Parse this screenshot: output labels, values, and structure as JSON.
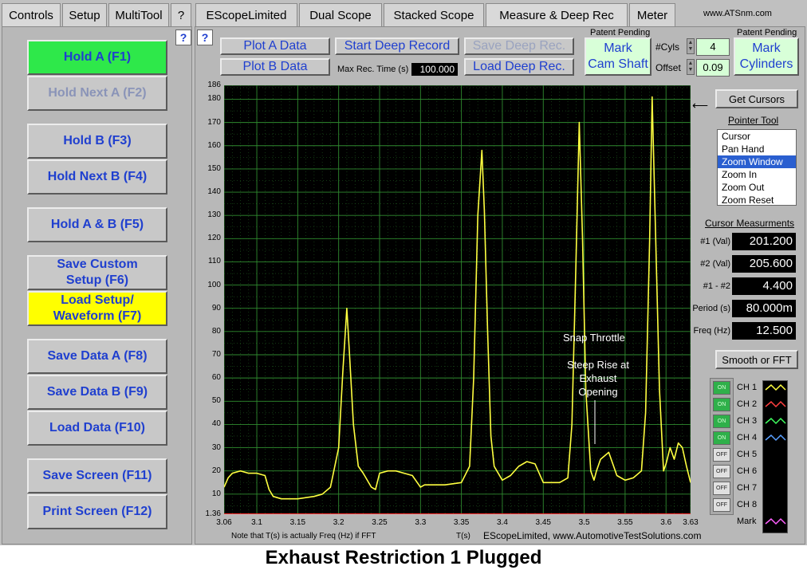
{
  "left_tabs": [
    "Controls",
    "Setup",
    "MultiTool",
    "?"
  ],
  "main_tabs": [
    "EScopeLimited",
    "Dual Scope",
    "Stacked Scope",
    "Measure & Deep Rec",
    "Meter"
  ],
  "brand_url": "www.ATSnm.com",
  "help_label": "?",
  "function_buttons": [
    {
      "label": "Hold A (F1)",
      "state": "green"
    },
    {
      "label": "Hold Next A (F2)",
      "state": "dim"
    },
    {
      "label": "Hold B (F3)",
      "state": "normal"
    },
    {
      "label": "Hold Next B (F4)",
      "state": "normal"
    },
    {
      "label": "Hold A & B (F5)",
      "state": "normal"
    },
    {
      "label": "Save Custom\nSetup (F6)",
      "state": "normal"
    },
    {
      "label": "Load Setup/\nWaveform (F7)",
      "state": "yellow"
    },
    {
      "label": "Save Data A (F8)",
      "state": "normal"
    },
    {
      "label": "Save Data B (F9)",
      "state": "normal"
    },
    {
      "label": "Load Data (F10)",
      "state": "normal"
    },
    {
      "label": "Save Screen (F11)",
      "state": "normal"
    },
    {
      "label": "Print Screen (F12)",
      "state": "normal"
    }
  ],
  "toolbar": {
    "plot_a": "Plot A Data",
    "plot_b": "Plot B Data",
    "start_deep": "Start Deep Record",
    "save_deep": "Save Deep Rec.",
    "load_deep": "Load Deep Rec.",
    "max_rec_label": "Max Rec. Time (s)",
    "max_rec_value": "100.000",
    "patent_pending": "Patent Pending",
    "mark_cam": "Mark\nCam Shaft",
    "cyls_label": "#Cyls",
    "cyls_value": "4",
    "offset_label": "Offset",
    "offset_value": "0.09",
    "mark_cyl": "Mark\nCylinders"
  },
  "right_panel": {
    "get_cursors": "Get Cursors",
    "pointer_tool_title": "Pointer Tool",
    "pointer_tools": [
      "Cursor",
      "Pan Hand",
      "Zoom Window",
      "Zoom In",
      "Zoom Out",
      "Zoom Reset"
    ],
    "pointer_selected_index": 2,
    "cursor_meas_title": "Cursor Measurments",
    "measurements": [
      {
        "label": "#1 (Val)",
        "value": "201.200"
      },
      {
        "label": "#2 (Val)",
        "value": "205.600"
      },
      {
        "label": "#1 - #2",
        "value": "4.400"
      },
      {
        "label": "Period (s)",
        "value": "80.000m"
      },
      {
        "label": "Freq (Hz)",
        "value": "12.500"
      }
    ],
    "smooth_fft": "Smooth or FFT",
    "channels": [
      {
        "name": "CH 1",
        "state": "ON",
        "color": "#ffff40"
      },
      {
        "name": "CH 2",
        "state": "ON",
        "color": "#ff4040"
      },
      {
        "name": "CH 3",
        "state": "ON",
        "color": "#40ff60"
      },
      {
        "name": "CH 4",
        "state": "ON",
        "color": "#5aa0ff"
      },
      {
        "name": "CH 5",
        "state": "OFF",
        "color": ""
      },
      {
        "name": "CH 6",
        "state": "OFF",
        "color": ""
      },
      {
        "name": "CH 7",
        "state": "OFF",
        "color": ""
      },
      {
        "name": "CH 8",
        "state": "OFF",
        "color": ""
      },
      {
        "name": "Mark",
        "state": "",
        "color": "#ff60ff"
      }
    ]
  },
  "chart_footer": {
    "fft_note": "Note that T(s) is actually Freq (Hz) if FFT",
    "t_label": "T(s)",
    "watermark": "EScopeLimited, www.AutomotiveTestSolutions.com"
  },
  "annotations": {
    "snap": "Snap Throttle",
    "steep": "Steep Rise at\nExhaust\nOpening"
  },
  "caption": "Exhaust Restriction 1 Plugged",
  "chart_data": {
    "type": "line",
    "xlim": [
      3.06,
      3.63
    ],
    "ylim": [
      1.36,
      186
    ],
    "x_ticks": [
      "3.06",
      "3.1",
      "3.15",
      "3.2",
      "3.25",
      "3.3",
      "3.35",
      "3.4",
      "3.45",
      "3.5",
      "3.55",
      "3.6",
      "3.63"
    ],
    "x_tick_values": [
      3.06,
      3.1,
      3.15,
      3.2,
      3.25,
      3.3,
      3.35,
      3.4,
      3.45,
      3.5,
      3.55,
      3.6,
      3.63
    ],
    "y_ticks": [
      "186",
      "180",
      "170",
      "160",
      "150",
      "140",
      "130",
      "120",
      "110",
      "100",
      "90",
      "80",
      "70",
      "60",
      "50",
      "40",
      "30",
      "20",
      "10",
      "1.36"
    ],
    "y_tick_values": [
      186,
      180,
      170,
      160,
      150,
      140,
      130,
      120,
      110,
      100,
      90,
      80,
      70,
      60,
      50,
      40,
      30,
      20,
      10,
      1.36
    ],
    "grid": true,
    "series": [
      {
        "color": "#ffff40",
        "x": [
          3.06,
          3.065,
          3.07,
          3.08,
          3.09,
          3.1,
          3.11,
          3.115,
          3.12,
          3.13,
          3.15,
          3.17,
          3.18,
          3.19,
          3.2,
          3.205,
          3.21,
          3.213,
          3.218,
          3.224,
          3.23,
          3.24,
          3.245,
          3.25,
          3.26,
          3.27,
          3.28,
          3.29,
          3.3,
          3.305,
          3.31,
          3.33,
          3.35,
          3.36,
          3.365,
          3.37,
          3.375,
          3.378,
          3.382,
          3.386,
          3.39,
          3.4,
          3.41,
          3.42,
          3.43,
          3.44,
          3.45,
          3.46,
          3.47,
          3.48,
          3.485,
          3.49,
          3.494,
          3.498,
          3.502,
          3.508,
          3.512,
          3.515,
          3.52,
          3.53,
          3.54,
          3.55,
          3.56,
          3.57,
          3.575,
          3.58,
          3.583,
          3.587,
          3.592,
          3.597,
          3.6,
          3.605,
          3.61,
          3.615,
          3.62,
          3.625,
          3.63
        ],
        "y": [
          13,
          17,
          19,
          20,
          19,
          19,
          18,
          12,
          9,
          8,
          8,
          9,
          10,
          13,
          30,
          62,
          90,
          72,
          40,
          22,
          19,
          13,
          12,
          19,
          20,
          20,
          19,
          18,
          13,
          14,
          14,
          14,
          15,
          22,
          60,
          130,
          158,
          132,
          80,
          35,
          22,
          16,
          18,
          22,
          24,
          23,
          15,
          15,
          15,
          17,
          40,
          110,
          170,
          120,
          55,
          20,
          16,
          20,
          25,
          28,
          18,
          16,
          17,
          20,
          45,
          120,
          181,
          125,
          55,
          20,
          23,
          30,
          25,
          32,
          30,
          22,
          15
        ]
      },
      {
        "color": "#ff3030",
        "x": [
          3.06,
          3.63
        ],
        "y": [
          1.36,
          1.36
        ]
      }
    ]
  }
}
